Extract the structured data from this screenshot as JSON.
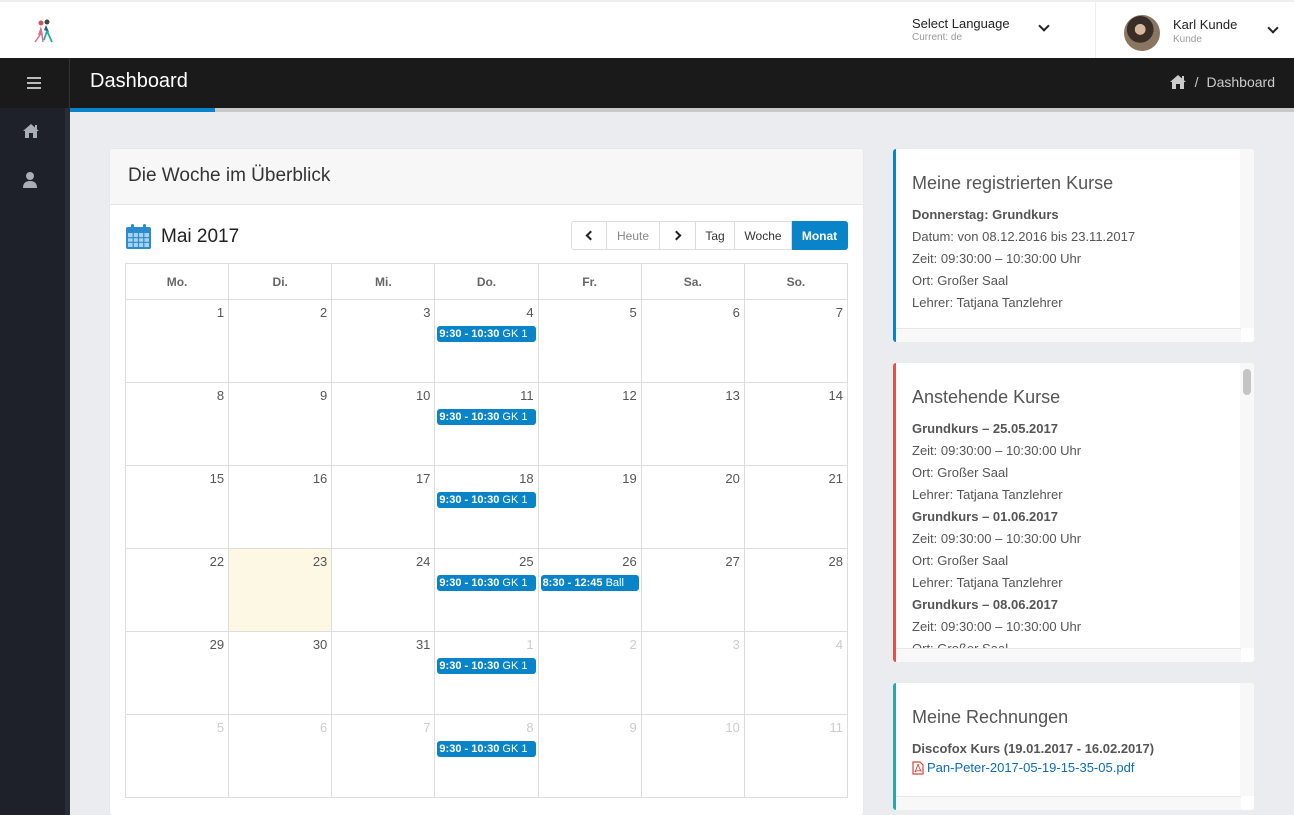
{
  "topbar": {
    "language": {
      "label": "Select Language",
      "current": "Current: de"
    },
    "user": {
      "name": "Karl Kunde",
      "role": "Kunde"
    }
  },
  "header": {
    "title": "Dashboard",
    "breadcrumb": {
      "separator": "/",
      "current": "Dashboard"
    }
  },
  "sidebar": {
    "items": [
      {
        "icon": "home-icon",
        "label": "Home"
      },
      {
        "icon": "user-icon",
        "label": "Profile"
      }
    ]
  },
  "calendar_card": {
    "title": "Die Woche im Überblick",
    "month_label": "Mai 2017",
    "buttons": {
      "prev": "<",
      "today": "Heute",
      "next": ">",
      "day": "Tag",
      "week": "Woche",
      "month": "Monat"
    },
    "active_view": "Monat",
    "weekdays": [
      "Mo.",
      "Di.",
      "Mi.",
      "Do.",
      "Fr.",
      "Sa.",
      "So."
    ],
    "weeks": [
      [
        {
          "day": "1"
        },
        {
          "day": "2"
        },
        {
          "day": "3"
        },
        {
          "day": "4",
          "event": {
            "time": "9:30 - 10:30",
            "title": "GK 1"
          }
        },
        {
          "day": "5"
        },
        {
          "day": "6"
        },
        {
          "day": "7"
        }
      ],
      [
        {
          "day": "8"
        },
        {
          "day": "9"
        },
        {
          "day": "10"
        },
        {
          "day": "11",
          "event": {
            "time": "9:30 - 10:30",
            "title": "GK 1"
          }
        },
        {
          "day": "12"
        },
        {
          "day": "13"
        },
        {
          "day": "14"
        }
      ],
      [
        {
          "day": "15"
        },
        {
          "day": "16"
        },
        {
          "day": "17"
        },
        {
          "day": "18",
          "event": {
            "time": "9:30 - 10:30",
            "title": "GK 1"
          }
        },
        {
          "day": "19"
        },
        {
          "day": "20"
        },
        {
          "day": "21"
        }
      ],
      [
        {
          "day": "22"
        },
        {
          "day": "23",
          "today": true
        },
        {
          "day": "24"
        },
        {
          "day": "25",
          "event": {
            "time": "9:30 - 10:30",
            "title": "GK 1"
          }
        },
        {
          "day": "26",
          "event": {
            "time": "8:30 - 12:45",
            "title": "Ball"
          }
        },
        {
          "day": "27"
        },
        {
          "day": "28"
        }
      ],
      [
        {
          "day": "29"
        },
        {
          "day": "30"
        },
        {
          "day": "31"
        },
        {
          "day": "1",
          "other": true,
          "event": {
            "time": "9:30 - 10:30",
            "title": "GK 1"
          }
        },
        {
          "day": "2",
          "other": true
        },
        {
          "day": "3",
          "other": true
        },
        {
          "day": "4",
          "other": true
        }
      ],
      [
        {
          "day": "5",
          "other": true
        },
        {
          "day": "6",
          "other": true
        },
        {
          "day": "7",
          "other": true
        },
        {
          "day": "8",
          "other": true,
          "event": {
            "time": "9:30 - 10:30",
            "title": "GK 1"
          }
        },
        {
          "day": "9",
          "other": true
        },
        {
          "day": "10",
          "other": true
        },
        {
          "day": "11",
          "other": true
        }
      ]
    ]
  },
  "registered_courses": {
    "title": "Meine registrierten Kurse",
    "accent": "#0a84c8",
    "lines": [
      {
        "text": "Donnerstag: Grundkurs",
        "bold": true
      },
      {
        "text": "Datum: von 08.12.2016 bis 23.11.2017"
      },
      {
        "text": "Zeit: 09:30:00 – 10:30:00 Uhr"
      },
      {
        "text": "Ort: Großer Saal"
      },
      {
        "text": "Lehrer: Tatjana Tanzlehrer"
      }
    ]
  },
  "upcoming_courses": {
    "title": "Anstehende Kurse",
    "accent": "#e0524a",
    "lines": [
      {
        "text": "Grundkurs – 25.05.2017",
        "bold": true
      },
      {
        "text": "Zeit: 09:30:00 – 10:30:00 Uhr"
      },
      {
        "text": "Ort: Großer Saal"
      },
      {
        "text": "Lehrer: Tatjana Tanzlehrer"
      },
      {
        "text": "Grundkurs – 01.06.2017",
        "bold": true
      },
      {
        "text": "Zeit: 09:30:00 – 10:30:00 Uhr"
      },
      {
        "text": "Ort: Großer Saal"
      },
      {
        "text": "Lehrer: Tatjana Tanzlehrer"
      },
      {
        "text": "Grundkurs – 08.06.2017",
        "bold": true
      },
      {
        "text": "Zeit: 09:30:00 – 10:30:00 Uhr"
      },
      {
        "text": "Ort: Großer Saal"
      }
    ]
  },
  "invoices": {
    "title": "Meine Rechnungen",
    "accent": "#2aa8a8",
    "course": "Discofox Kurs (19.01.2017 - 16.02.2017)",
    "file": "Pan-Peter-2017-05-19-15-35-05.pdf"
  },
  "colors": {
    "primary": "#0a84c8",
    "today_bg": "#fcf8e3",
    "header_bg": "#1a1a1a",
    "sidebar_bg": "#1e2129"
  }
}
